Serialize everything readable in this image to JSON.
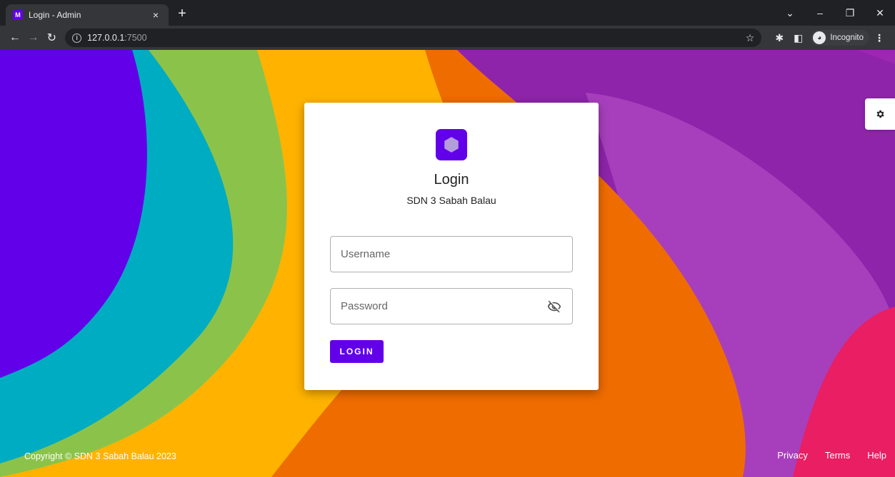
{
  "browser": {
    "tab_title": "Login - Admin",
    "tab_close": "×",
    "new_tab": "+",
    "url_host": "127.0.0.1",
    "url_port": ":7500",
    "incognito_label": "Incognito",
    "window_controls": [
      "⌄",
      "–",
      "❐",
      "✕"
    ]
  },
  "settings": {
    "icon": "gear-icon"
  },
  "login": {
    "logo": "hexagon-icon",
    "title": "Login",
    "school": "SDN 3 Sabah Balau",
    "username_placeholder": "Username",
    "password_placeholder": "Password",
    "password_toggle": "eye-off-icon",
    "button_label": "LOGIN"
  },
  "footer": {
    "copyright": "Copyright © SDN 3 Sabah Balau 2023",
    "links": [
      "Privacy",
      "Terms",
      "Help"
    ]
  },
  "colors": {
    "accent": "#6200ea",
    "bg_purple": "#9c27b0",
    "bg_cyan": "#00acc1",
    "bg_green": "#8bc34a",
    "bg_amber": "#ffb300",
    "bg_orange": "#ef6c00",
    "bg_pink": "#e91e63"
  }
}
